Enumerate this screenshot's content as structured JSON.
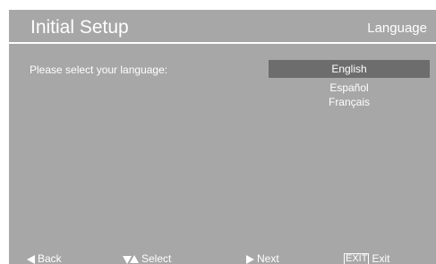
{
  "header": {
    "title": "Initial Setup",
    "section": "Language"
  },
  "main": {
    "prompt": "Please select your language:",
    "languages": [
      {
        "label": "English",
        "selected": true
      },
      {
        "label": "Español",
        "selected": false
      },
      {
        "label": "Français",
        "selected": false
      }
    ]
  },
  "footer": {
    "back": {
      "icon": "triangle-left-icon",
      "label": "Back"
    },
    "select": {
      "icon": "up-down-arrows-icon",
      "label": "Select"
    },
    "next": {
      "icon": "triangle-right-icon",
      "label": "Next"
    },
    "exit": {
      "key_label": "EXIT",
      "label": "Exit"
    }
  },
  "colors": {
    "background": "#a7a7a7",
    "selection": "#6d6d6d",
    "text": "#ffffff"
  }
}
